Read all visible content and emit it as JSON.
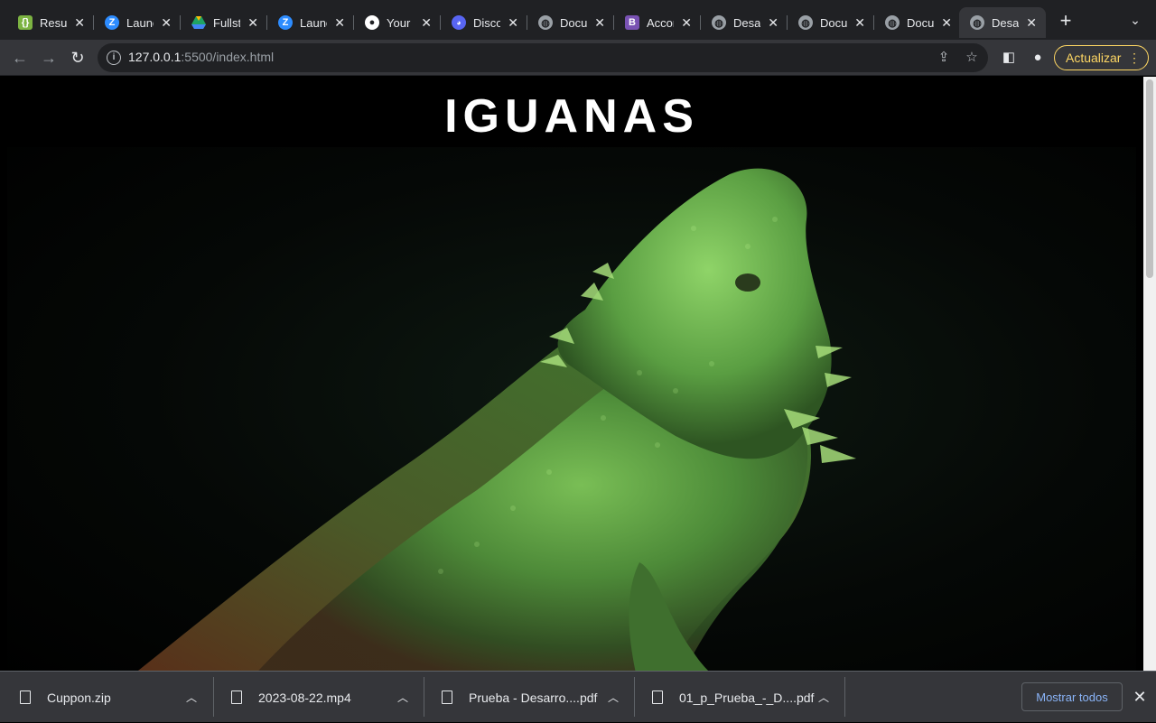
{
  "tabs": [
    {
      "title": "Resur",
      "icon": "curly-braces-icon",
      "color": "#7cb342"
    },
    {
      "title": "Launc",
      "icon": "zoom-icon",
      "color": "#2d8cff"
    },
    {
      "title": "Fullst",
      "icon": "drive-icon",
      "color": "#fbbc04"
    },
    {
      "title": "Launc",
      "icon": "zoom-icon",
      "color": "#2d8cff"
    },
    {
      "title": "Your I",
      "icon": "github-icon",
      "color": "#ffffff"
    },
    {
      "title": "Disco",
      "icon": "discord-icon",
      "color": "#5865f2"
    },
    {
      "title": "Docur",
      "icon": "globe-icon",
      "color": "#9aa0a6"
    },
    {
      "title": "Accor",
      "icon": "bootstrap-icon",
      "color": "#7952b3"
    },
    {
      "title": "Desaf",
      "icon": "globe-icon",
      "color": "#9aa0a6"
    },
    {
      "title": "Docu",
      "icon": "globe-icon",
      "color": "#9aa0a6"
    },
    {
      "title": "Docu",
      "icon": "globe-icon",
      "color": "#9aa0a6"
    },
    {
      "title": "Desaf",
      "icon": "globe-icon",
      "color": "#9aa0a6",
      "active": true
    }
  ],
  "address": {
    "host": "127.0.0.1",
    "path": ":5500/index.html"
  },
  "toolbar": {
    "update_label": "Actualizar"
  },
  "page": {
    "heading": "IGUANAS"
  },
  "downloads": [
    {
      "name": "Cuppon.zip"
    },
    {
      "name": "2023-08-22.mp4"
    },
    {
      "name": "Prueba - Desarro....pdf"
    },
    {
      "name": "01_p_Prueba_-_D....pdf"
    }
  ],
  "download_bar": {
    "show_all_label": "Mostrar todos"
  }
}
